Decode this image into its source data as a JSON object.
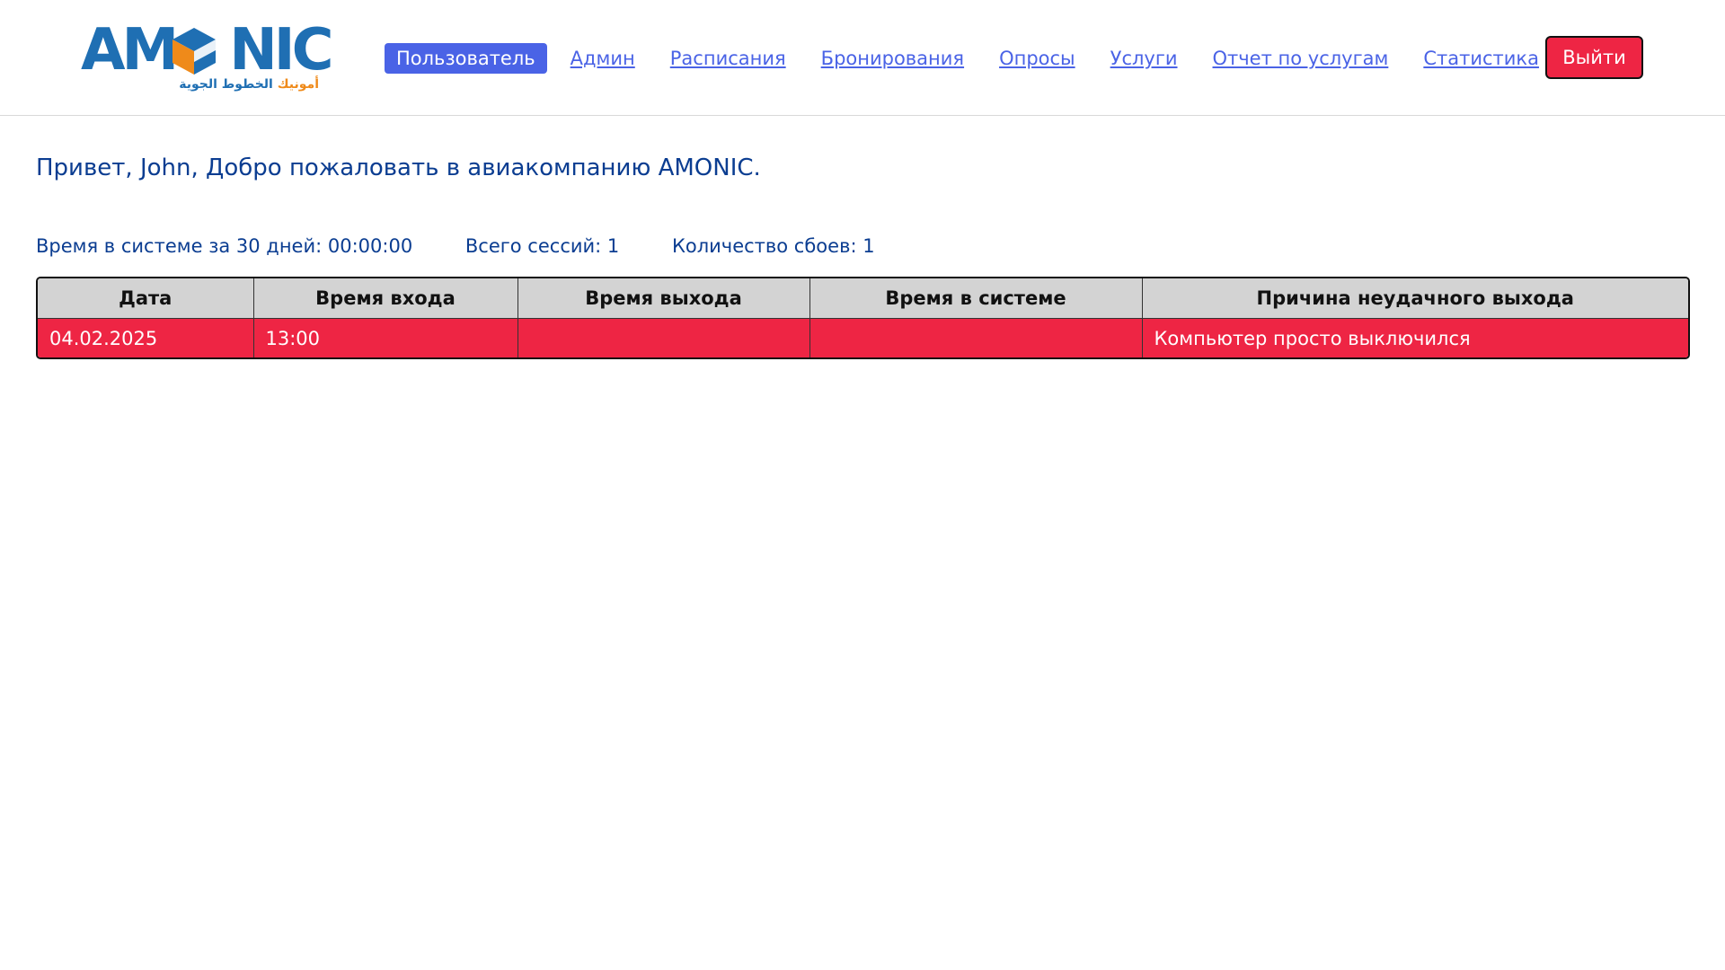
{
  "brand": {
    "logo_text_left": "AM",
    "logo_text_right": "NIC",
    "logo_arabic_orange": "أمونيك",
    "logo_arabic_blue": "الخطوط الجوية"
  },
  "nav": {
    "active": "Пользователь",
    "links": [
      "Админ",
      "Расписания",
      "Бронирования",
      "Опросы",
      "Услуги",
      "Отчет по услугам",
      "Статистика"
    ],
    "logout": "Выйти"
  },
  "greeting": "Привет, John, Добро пожаловать в авиакомпанию AMONIC.",
  "stats": {
    "time_30_days": "Время в системе за 30 дней: 00:00:00",
    "total_sessions": "Всего сессий: 1",
    "crash_count": "Количество сбоев: 1"
  },
  "table": {
    "headers": [
      "Дата",
      "Время входа",
      "Время выхода",
      "Время в системе",
      "Причина неудачного выхода"
    ],
    "rows": [
      [
        "04.02.2025",
        "13:00",
        "",
        "",
        "Компьютер просто выключился"
      ]
    ]
  },
  "colors": {
    "accent": "#4a63e6",
    "danger": "#ee2544",
    "text_blue": "#0b3d91",
    "header_gray": "#d3d3d3",
    "brand_blue": "#1f6fb3",
    "brand_orange": "#ef8a1a"
  }
}
